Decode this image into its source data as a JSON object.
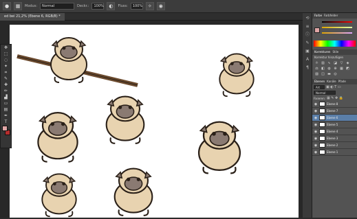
{
  "options_bar": {
    "mode_label": "Modus:",
    "mode_value": "Normal",
    "opacity_label": "Deckr.:",
    "opacity_value": "100%",
    "flow_label": "Fluss:",
    "flow_value": "100%"
  },
  "document_tab": {
    "title": "ed bei 21,2% (Ebene 6, RGB/8) *"
  },
  "panels": {
    "color_tabs": [
      "Farbe",
      "Farbfelder"
    ],
    "adjust_tabs": [
      "Korrekturen",
      "Stile"
    ],
    "adjust_label": "Korrektur hinzufügen",
    "layer_tabs": [
      "Ebenen",
      "Kanäle",
      "Pfade"
    ],
    "kind_label": "Art",
    "blend_mode": "Normal",
    "fill_label": "Fixieren:"
  },
  "layers": [
    {
      "name": "Ebene 8",
      "selected": false
    },
    {
      "name": "Ebene 7",
      "selected": false
    },
    {
      "name": "Ebene 6",
      "selected": true
    },
    {
      "name": "Ebene 5",
      "selected": false
    },
    {
      "name": "Ebene 4",
      "selected": false
    },
    {
      "name": "Ebene 3",
      "selected": false
    },
    {
      "name": "Ebene 2",
      "selected": false
    },
    {
      "name": "Ebene 1",
      "selected": false
    }
  ],
  "colors": {
    "foreground": "#e0a6a6",
    "background": "#b52d2d",
    "pug_fill": "#e8d3b0",
    "pug_mask": "#8a7a72",
    "pug_outline": "#2a2018",
    "canvas": "#ffffff"
  },
  "icons": {
    "tools": [
      "move-icon",
      "marquee-icon",
      "lasso-icon",
      "wand-icon",
      "crop-icon",
      "eyedropper-icon",
      "heal-icon",
      "brush-icon",
      "stamp-icon",
      "history-brush-icon",
      "eraser-icon",
      "gradient-icon",
      "blur-icon",
      "dodge-icon",
      "pen-icon",
      "text-icon"
    ]
  }
}
